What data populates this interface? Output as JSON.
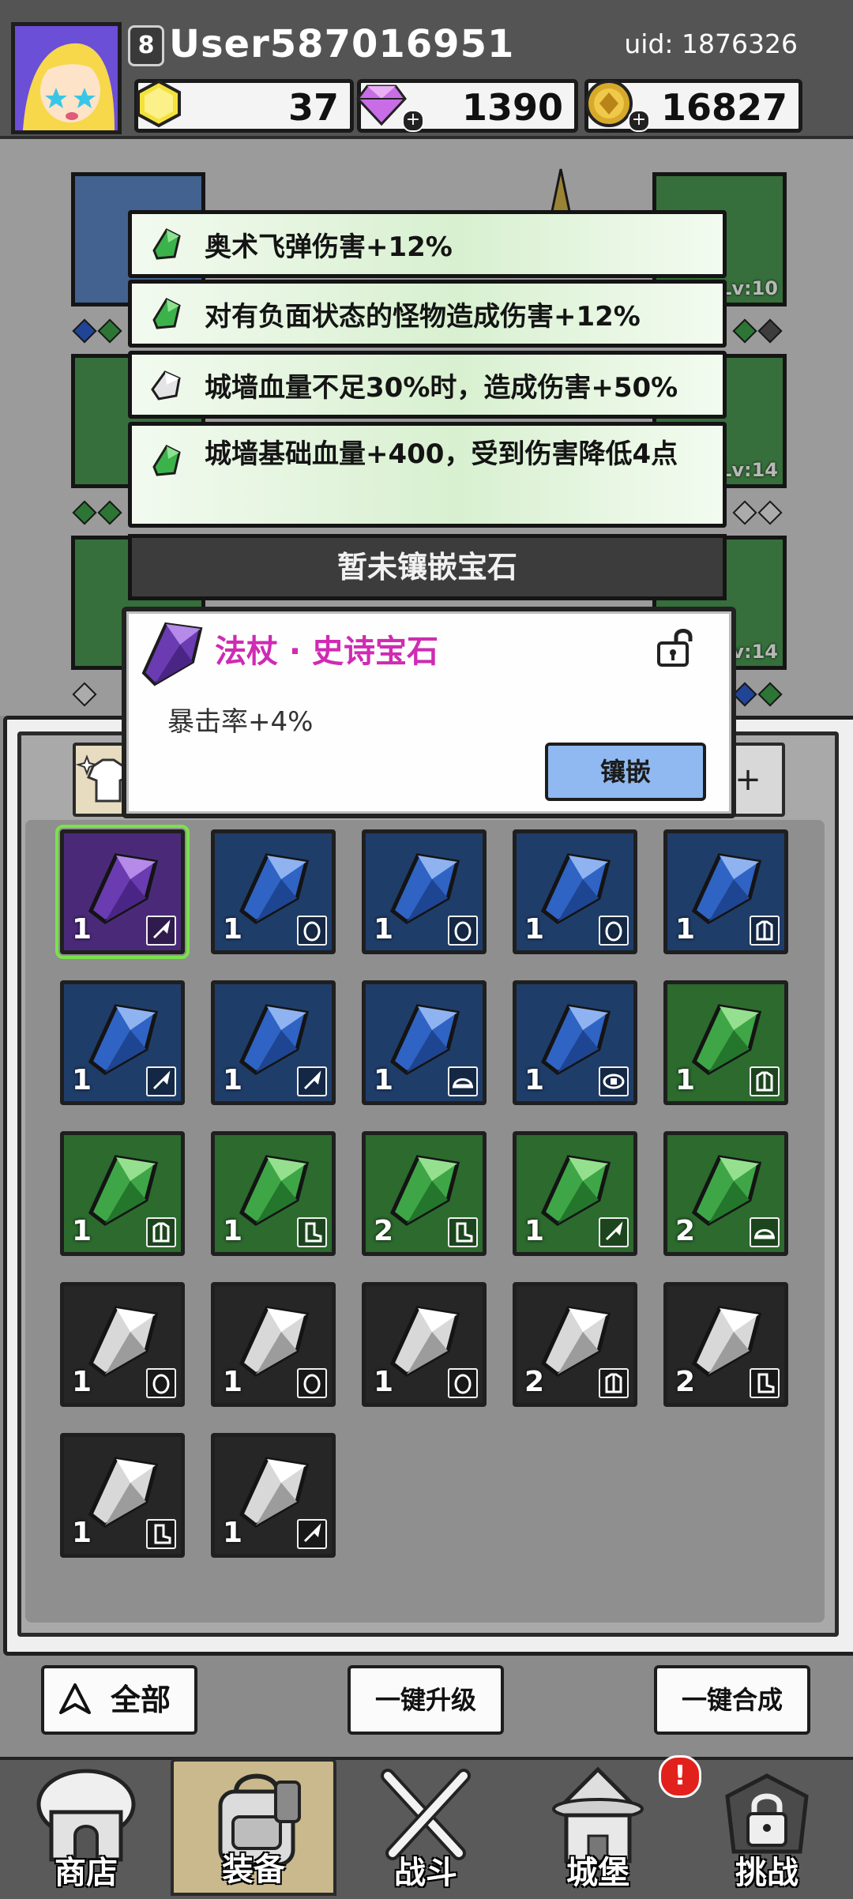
{
  "player": {
    "level": "8",
    "username": "User587016951",
    "uid": "uid: 1876326"
  },
  "resources": {
    "gold_hex": "37",
    "diamonds": "1390",
    "coins": "16827"
  },
  "equipment_slots": [
    {
      "side": "left",
      "row": 0,
      "lv": ""
    },
    {
      "side": "left",
      "row": 1,
      "lv": ""
    },
    {
      "side": "left",
      "row": 2,
      "lv": ""
    },
    {
      "side": "right",
      "row": 0,
      "lv": "Lv:10"
    },
    {
      "side": "right",
      "row": 1,
      "lv": "Lv:14"
    },
    {
      "side": "right",
      "row": 2,
      "lv": "Lv:14"
    }
  ],
  "effects": [
    {
      "gem": "green",
      "text": "奥术飞弹伤害+12%"
    },
    {
      "gem": "green",
      "text": "对有负面状态的怪物造成伤害+12%"
    },
    {
      "gem": "white",
      "text": "城墙血量不足30%时，造成伤害+50%"
    },
    {
      "gem": "green",
      "text": "城墙基础血量+400，受到伤害降低4点"
    }
  ],
  "not_inlaid_label": "暂未镶嵌宝石",
  "popup": {
    "title": "法杖 · 史诗宝石",
    "description": "暴击率+4%",
    "inlay_button": "镶嵌"
  },
  "filter_right_label": "+",
  "gems": [
    {
      "rarity": "epic",
      "count": "1",
      "slot": "staff-icon",
      "selected": true
    },
    {
      "rarity": "rare",
      "count": "1",
      "slot": "ring-icon"
    },
    {
      "rarity": "rare",
      "count": "1",
      "slot": "ring-icon"
    },
    {
      "rarity": "rare",
      "count": "1",
      "slot": "ring-icon"
    },
    {
      "rarity": "rare",
      "count": "1",
      "slot": "armor-icon"
    },
    {
      "rarity": "rare",
      "count": "1",
      "slot": "staff-icon"
    },
    {
      "rarity": "rare",
      "count": "1",
      "slot": "staff-icon"
    },
    {
      "rarity": "rare",
      "count": "1",
      "slot": "hat-icon"
    },
    {
      "rarity": "rare",
      "count": "1",
      "slot": "belt-icon"
    },
    {
      "rarity": "uncommon",
      "count": "1",
      "slot": "armor-icon"
    },
    {
      "rarity": "uncommon",
      "count": "1",
      "slot": "armor-icon"
    },
    {
      "rarity": "uncommon",
      "count": "1",
      "slot": "boot-icon"
    },
    {
      "rarity": "uncommon",
      "count": "2",
      "slot": "boot-icon"
    },
    {
      "rarity": "uncommon",
      "count": "1",
      "slot": "staff-icon"
    },
    {
      "rarity": "uncommon",
      "count": "2",
      "slot": "hat-icon"
    },
    {
      "rarity": "common",
      "count": "1",
      "slot": "ring-icon"
    },
    {
      "rarity": "common",
      "count": "1",
      "slot": "ring-icon"
    },
    {
      "rarity": "common",
      "count": "1",
      "slot": "ring-icon"
    },
    {
      "rarity": "common",
      "count": "2",
      "slot": "armor-icon"
    },
    {
      "rarity": "common",
      "count": "2",
      "slot": "boot-icon"
    },
    {
      "rarity": "common",
      "count": "1",
      "slot": "boot-icon"
    },
    {
      "rarity": "common",
      "count": "1",
      "slot": "staff-icon"
    }
  ],
  "actions": {
    "filter_all": "全部",
    "upgrade_all": "一键升级",
    "merge_all": "一键合成"
  },
  "nav": [
    {
      "label": "商店",
      "icon": "shop-icon"
    },
    {
      "label": "装备",
      "icon": "backpack-icon",
      "active": true
    },
    {
      "label": "战斗",
      "icon": "crossed-swords-icon"
    },
    {
      "label": "城堡",
      "icon": "castle-icon",
      "alert": "!"
    },
    {
      "label": "挑战",
      "icon": "locked-challenge-icon"
    }
  ],
  "colors": {
    "epic": "#4a2a78",
    "rare": "#1f3d69",
    "uncommon": "#2c6a2e",
    "common": "#262626",
    "popup_title": "#cf2bb3",
    "inlay_button": "#8fb9f0"
  }
}
